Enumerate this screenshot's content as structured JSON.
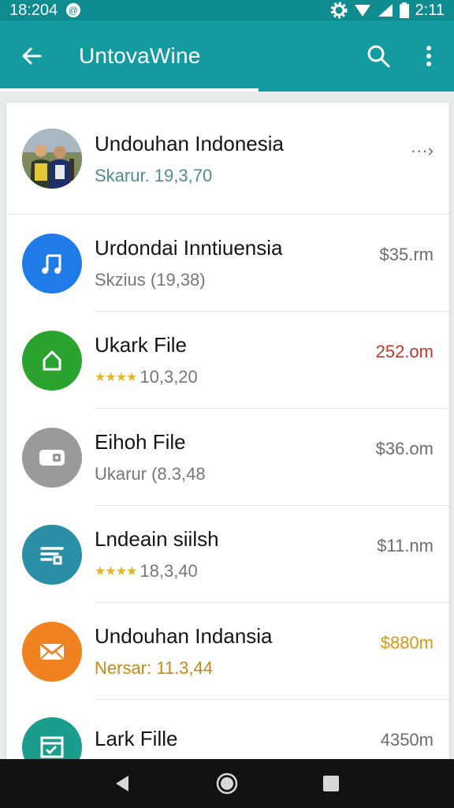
{
  "status_bar": {
    "left_time": "18:204",
    "right_time": "2:11",
    "icons": [
      "notification-icon",
      "gear-icon",
      "wifi-icon",
      "signal-icon",
      "battery-icon"
    ]
  },
  "app_bar": {
    "title": "UntovaWine",
    "icons": [
      "back-arrow-icon",
      "search-icon",
      "more-vert-icon"
    ]
  },
  "colors": {
    "status_bar": "#0e8c8f",
    "app_bar": "#139ba0",
    "blue": "#1f7be8",
    "green": "#2aa42f",
    "gray": "#9a9a9a",
    "teal": "#2a8fa6",
    "orange": "#f0821f",
    "red": "#c0392b",
    "amber": "#d69a12"
  },
  "items": [
    {
      "title": "Undouhan Indonesia",
      "subtitle": "Skarur. 19,3,70",
      "meta": "···›",
      "icon": "photo-avatar"
    },
    {
      "title": "Urdondai Inntiuensia",
      "subtitle": "Skzius (19,38)",
      "meta": "$35.rm",
      "icon": "music-note-icon"
    },
    {
      "title": "Ukark File",
      "subtitle": "10,3,20",
      "stars": "★★★★",
      "meta": "252.om",
      "icon": "home-icon"
    },
    {
      "title": "Eihoh File",
      "subtitle": "Ukarur (8.3,48",
      "meta": "$36.om",
      "icon": "wallet-icon"
    },
    {
      "title": "Lndeain siilsh",
      "subtitle": "18,3,40",
      "stars": "★★★★",
      "meta": "$11.nm",
      "icon": "file-lines-icon"
    },
    {
      "title": "Undouhan Indansia",
      "subtitle": "Nersar: 11.3,44",
      "meta": "$880m",
      "icon": "mail-icon"
    },
    {
      "title": "Lark Fille",
      "subtitle": "",
      "meta": "4350m",
      "icon": "check-doc-icon"
    }
  ],
  "nav_bar": {
    "icons": [
      "back-triangle-icon",
      "home-circle-icon",
      "recents-square-icon"
    ]
  }
}
